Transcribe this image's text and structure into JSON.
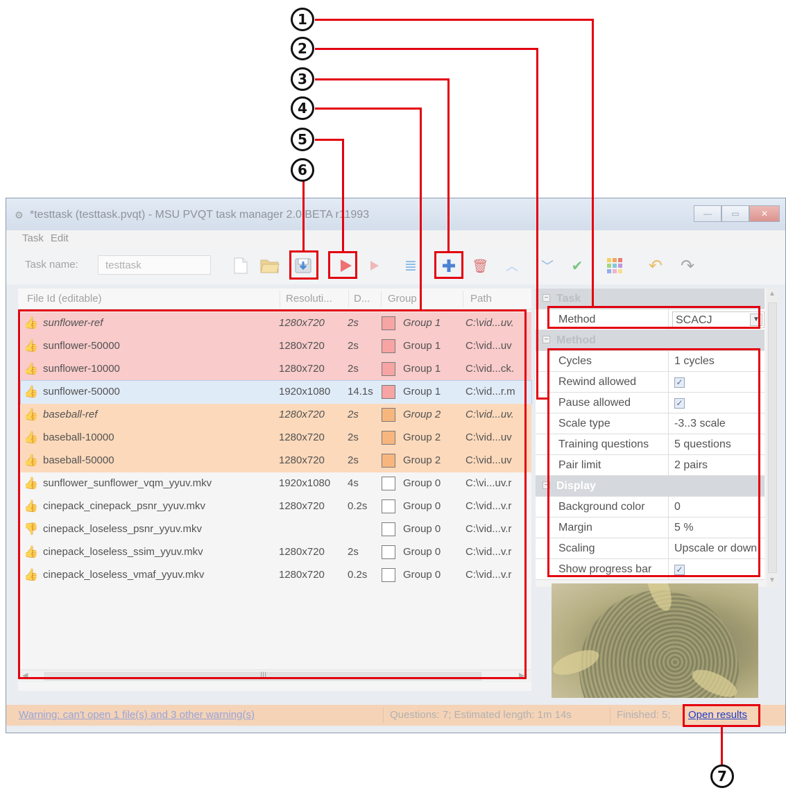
{
  "window": {
    "title": "*testtask (testtask.pvqt) - MSU PVQT task manager 2.0 BETA r11993",
    "minimize": "—",
    "maximize": "▭",
    "close": "✕"
  },
  "menu": [
    "Task",
    "Edit"
  ],
  "toolbar": {
    "task_name_label": "Task name:",
    "task_name_value": "testtask"
  },
  "table": {
    "headers": [
      "File Id (editable)",
      "Resoluti...",
      "D...",
      "Group",
      "Path"
    ],
    "rows": [
      {
        "id": "sunflower-ref",
        "res": "1280x720",
        "dur": "2s",
        "group": "Group 1",
        "path": "C:\\vid...uv.",
        "style": "red",
        "italic": true,
        "color": "#f58b8b",
        "ok": true
      },
      {
        "id": "sunflower-50000",
        "res": "1280x720",
        "dur": "2s",
        "group": "Group 1",
        "path": "C:\\vid...uv",
        "style": "red",
        "italic": false,
        "color": "#f58b8b",
        "ok": true
      },
      {
        "id": "sunflower-10000",
        "res": "1280x720",
        "dur": "2s",
        "group": "Group 1",
        "path": "C:\\vid...ck.",
        "style": "red",
        "italic": false,
        "color": "#f58b8b",
        "ok": true
      },
      {
        "id": "sunflower-50000",
        "res": "1920x1080",
        "dur": "14.1s",
        "group": "Group 1",
        "path": "C:\\vid...r.m",
        "style": "sel",
        "italic": false,
        "color": "#f58b8b",
        "ok": true
      },
      {
        "id": "baseball-ref",
        "res": "1280x720",
        "dur": "2s",
        "group": "Group 2",
        "path": "C:\\vid...uv.",
        "style": "orange",
        "italic": true,
        "color": "#f7a25c",
        "ok": true
      },
      {
        "id": "baseball-10000",
        "res": "1280x720",
        "dur": "2s",
        "group": "Group 2",
        "path": "C:\\vid...uv",
        "style": "orange",
        "italic": false,
        "color": "#f7a25c",
        "ok": true
      },
      {
        "id": "baseball-50000",
        "res": "1280x720",
        "dur": "2s",
        "group": "Group 2",
        "path": "C:\\vid...uv",
        "style": "orange",
        "italic": false,
        "color": "#f7a25c",
        "ok": true
      },
      {
        "id": "sunflower_sunflower_vqm_yyuv.mkv",
        "res": "1920x1080",
        "dur": "4s",
        "group": "Group 0",
        "path": "C:\\vi...uv.r",
        "style": "",
        "italic": false,
        "color": "#ffffff",
        "ok": true
      },
      {
        "id": "cinepack_cinepack_psnr_yyuv.mkv",
        "res": "1280x720",
        "dur": "0.2s",
        "group": "Group 0",
        "path": "C:\\vid...v.r",
        "style": "",
        "italic": false,
        "color": "#ffffff",
        "ok": true
      },
      {
        "id": "cinepack_loseless_psnr_yyuv.mkv",
        "res": "",
        "dur": "",
        "group": "Group 0",
        "path": "C:\\vid...v.r",
        "style": "",
        "italic": false,
        "color": "#ffffff",
        "ok": false
      },
      {
        "id": "cinepack_loseless_ssim_yyuv.mkv",
        "res": "1280x720",
        "dur": "2s",
        "group": "Group 0",
        "path": "C:\\vid...v.r",
        "style": "",
        "italic": false,
        "color": "#ffffff",
        "ok": true
      },
      {
        "id": "cinepack_loseless_vmaf_yyuv.mkv",
        "res": "1280x720",
        "dur": "0.2s",
        "group": "Group 0",
        "path": "C:\\vid...v.r",
        "style": "",
        "italic": false,
        "color": "#ffffff",
        "ok": true
      }
    ],
    "scroll_grip": "III"
  },
  "properties": {
    "cat_task": "Task",
    "method_label": "Method",
    "method_value": "SCACJ",
    "cat_method": "Method",
    "cycles_label": "Cycles",
    "cycles_value": "1 cycles",
    "rewind_label": "Rewind allowed",
    "pause_label": "Pause allowed",
    "scale_type_label": "Scale type",
    "scale_type_value": "-3..3 scale",
    "training_label": "Training questions",
    "training_value": "5 questions",
    "pair_label": "Pair limit",
    "pair_value": "2 pairs",
    "cat_display": "Display",
    "bg_label": "Background color",
    "bg_value": "0",
    "margin_label": "Margin",
    "margin_value": "5 %",
    "scaling_label": "Scaling",
    "scaling_value": "Upscale or down",
    "progress_label": "Show progress bar",
    "checkmark": "✓"
  },
  "status": {
    "warning": "Warning: can't open 1 file(s) and 3 other warning(s)",
    "questions": "Questions: 7; Estimated length: 1m 14s",
    "finished": "Finished: 5;",
    "open_results": "Open results"
  },
  "callouts": [
    "1",
    "2",
    "3",
    "4",
    "5",
    "6",
    "7"
  ],
  "colors": {
    "highlight": "#e3000f",
    "group1": "#f58b8b",
    "group2": "#f7a25c",
    "link": "#1b3fc8"
  }
}
